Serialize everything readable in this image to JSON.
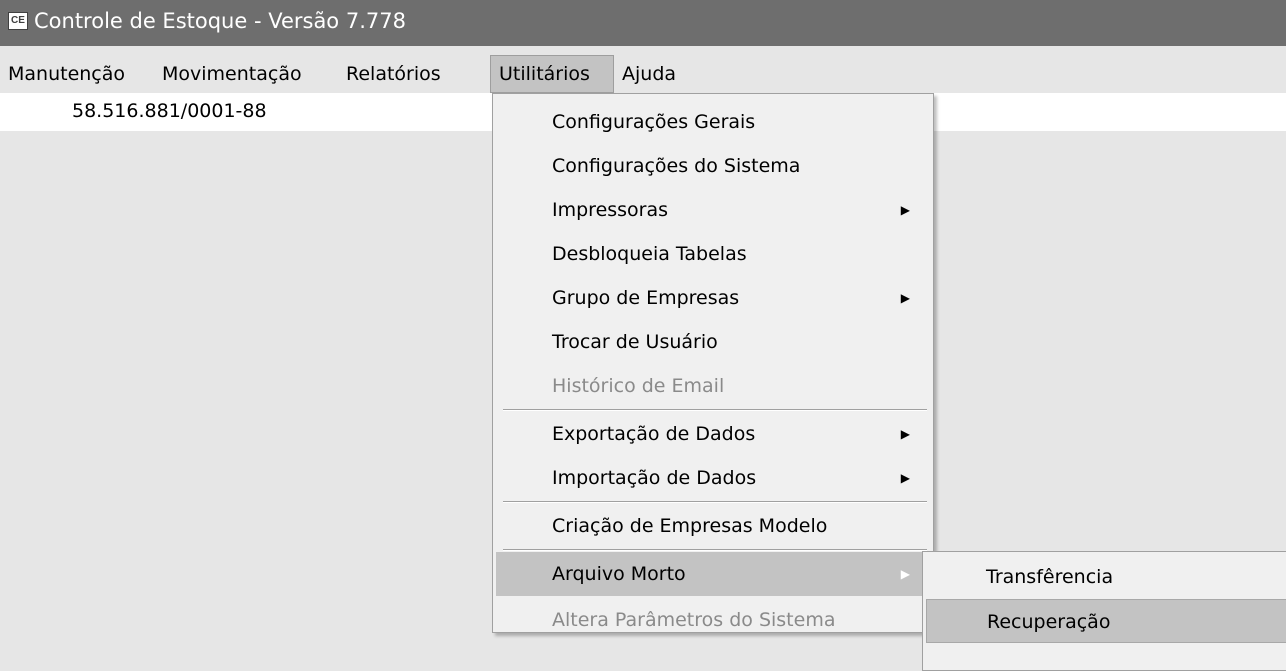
{
  "window": {
    "title": "Controle de Estoque - Versão 7.778",
    "icon_text": "CE"
  },
  "menubar": [
    {
      "label": "Manutenção"
    },
    {
      "label": "Movimentação"
    },
    {
      "label": "Relatórios"
    },
    {
      "label": "Utilitários",
      "active": true
    },
    {
      "label": "Ajuda"
    }
  ],
  "info": {
    "cnpj": "58.516.881/0001-88"
  },
  "dropdown": {
    "items": [
      {
        "label": "Configurações Gerais"
      },
      {
        "label": "Configurações do Sistema"
      },
      {
        "label": "Impressoras",
        "submenu": true
      },
      {
        "label": "Desbloqueia Tabelas"
      },
      {
        "label": "Grupo de Empresas",
        "submenu": true
      },
      {
        "label": "Trocar de Usuário"
      },
      {
        "label": "Histórico de Email",
        "disabled": true
      },
      {
        "label": "Exportação de Dados",
        "submenu": true
      },
      {
        "label": "Importação de Dados",
        "submenu": true
      },
      {
        "label": "Criação de Empresas Modelo"
      },
      {
        "label": "Arquivo Morto",
        "submenu": true,
        "highlighted": true
      },
      {
        "label": "Altera Parâmetros do Sistema",
        "disabled": true
      }
    ]
  },
  "submenu": {
    "items": [
      {
        "label": "Transfêrencia"
      },
      {
        "label": "Recuperação",
        "highlighted": true
      }
    ]
  },
  "icons": {
    "submenu_arrow": "▶"
  }
}
